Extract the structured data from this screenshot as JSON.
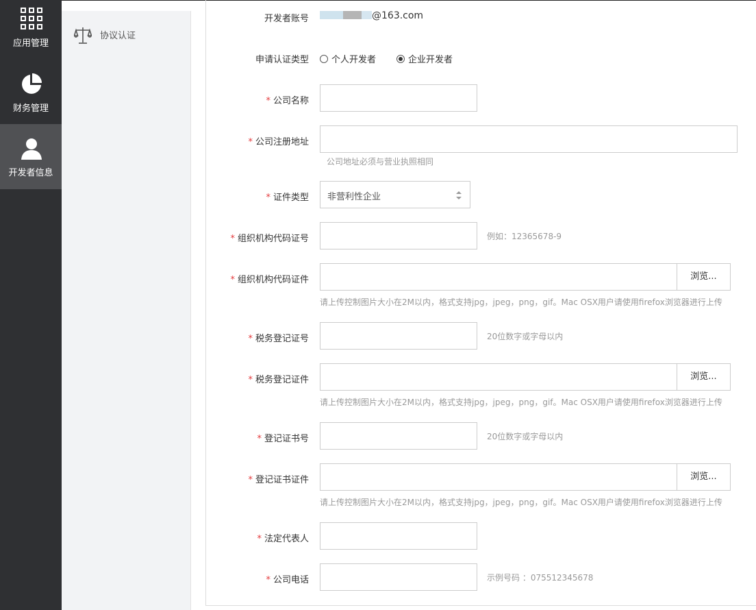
{
  "nav": {
    "items": [
      {
        "label": "应用管理",
        "icon": "grid-icon"
      },
      {
        "label": "财务管理",
        "icon": "pie-chart-icon"
      },
      {
        "label": "开发者信息",
        "icon": "user-icon",
        "active": true
      }
    ]
  },
  "subnav": {
    "items": [
      {
        "label": "协议认证",
        "icon": "scale-icon"
      }
    ]
  },
  "form": {
    "account": {
      "label": "开发者账号",
      "value": "@163.com"
    },
    "cert_type": {
      "label": "申请认证类型",
      "options": [
        {
          "label": "个人开发者",
          "selected": false
        },
        {
          "label": "企业开发者",
          "selected": true
        }
      ]
    },
    "company_name": {
      "label": "公司名称",
      "value": ""
    },
    "company_address": {
      "label": "公司注册地址",
      "value": "",
      "hint": "公司地址必须与营业执照相同"
    },
    "doc_type": {
      "label": "证件类型",
      "value": "非营利性企业"
    },
    "org_code": {
      "label": "组织机构代码证号",
      "value": "",
      "hint": "例如：12365678-9"
    },
    "org_code_file": {
      "label": "组织机构代码证件",
      "value": "",
      "browse": "浏览...",
      "hint": "请上传控制图片大小在2M以内，格式支持jpg，jpeg，png，gif。Mac OSX用户请使用firefox浏览器进行上传"
    },
    "tax_no": {
      "label": "税务登记证号",
      "value": "",
      "hint": "20位数字或字母以内"
    },
    "tax_file": {
      "label": "税务登记证件",
      "value": "",
      "browse": "浏览...",
      "hint": "请上传控制图片大小在2M以内，格式支持jpg，jpeg，png，gif。Mac OSX用户请使用firefox浏览器进行上传"
    },
    "reg_no": {
      "label": "登记证书号",
      "value": "",
      "hint": "20位数字或字母以内"
    },
    "reg_file": {
      "label": "登记证书证件",
      "value": "",
      "browse": "浏览...",
      "hint": "请上传控制图片大小在2M以内，格式支持jpg，jpeg，png，gif。Mac OSX用户请使用firefox浏览器进行上传"
    },
    "legal_rep": {
      "label": "法定代表人",
      "value": ""
    },
    "phone": {
      "label": "公司电话",
      "value": "",
      "hint": "示例号码 ：075512345678"
    },
    "required_mark": "*"
  }
}
